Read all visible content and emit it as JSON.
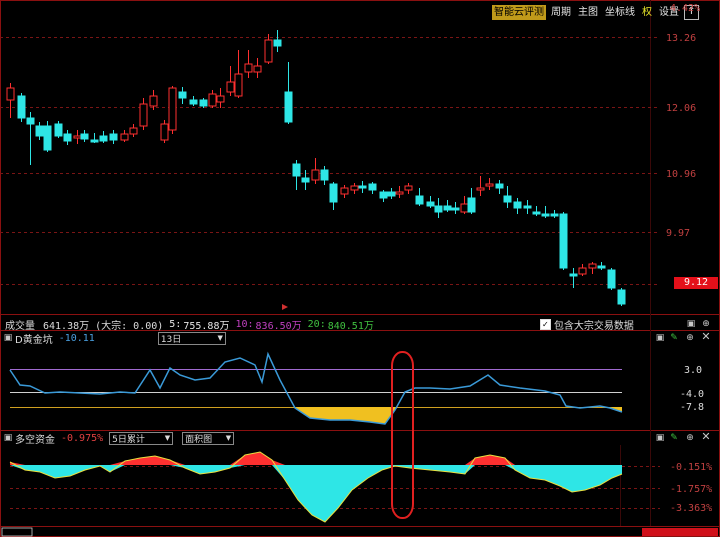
{
  "toolbar": {
    "items": [
      "智能云评测",
      "周期",
      "主图",
      "坐标线",
      "权",
      "设置"
    ],
    "up_icon": "up-arrow-icon"
  },
  "price_axis": {
    "top_pct": "4.42%",
    "labels": [
      "13.26",
      "12.06",
      "10.96",
      "9.97"
    ],
    "last_price": "9.12"
  },
  "volume_bar": {
    "label": "成交量",
    "value": "641.38万",
    "block": "(大宗: 0.00)",
    "ma5_label": "5:",
    "ma5_value": "755.88万",
    "ma10_label": "10:",
    "ma10_value": "836.50万",
    "ma20_label": "20:",
    "ma20_value": "840.51万",
    "checkbox_label": "包含大宗交易数据",
    "checkbox_checked": true
  },
  "indicator1": {
    "name": "D黄金坑",
    "value": "-10.11",
    "period": "13日",
    "levels": [
      "3.0",
      "-4.0",
      "-7.8"
    ]
  },
  "indicator2": {
    "name": "多空资金",
    "value": "-0.975%",
    "period": "5日累计",
    "chart_style": "面积图",
    "levels": [
      "-0.151%",
      "-1.757%",
      "-3.363%"
    ]
  },
  "colors": {
    "up": "#ff3030",
    "down": "#2ee6e6",
    "volume_ma5": "#e6e6e6",
    "volume_ma10": "#c040c0",
    "volume_ma20": "#40c040",
    "gold_fill": "#f0c020",
    "highlight": "#e02020"
  },
  "chart_data": {
    "type": "candlestick",
    "ylabels": [
      "13.26",
      "12.06",
      "10.96",
      "9.97"
    ],
    "last": 9.12,
    "series": []
  }
}
